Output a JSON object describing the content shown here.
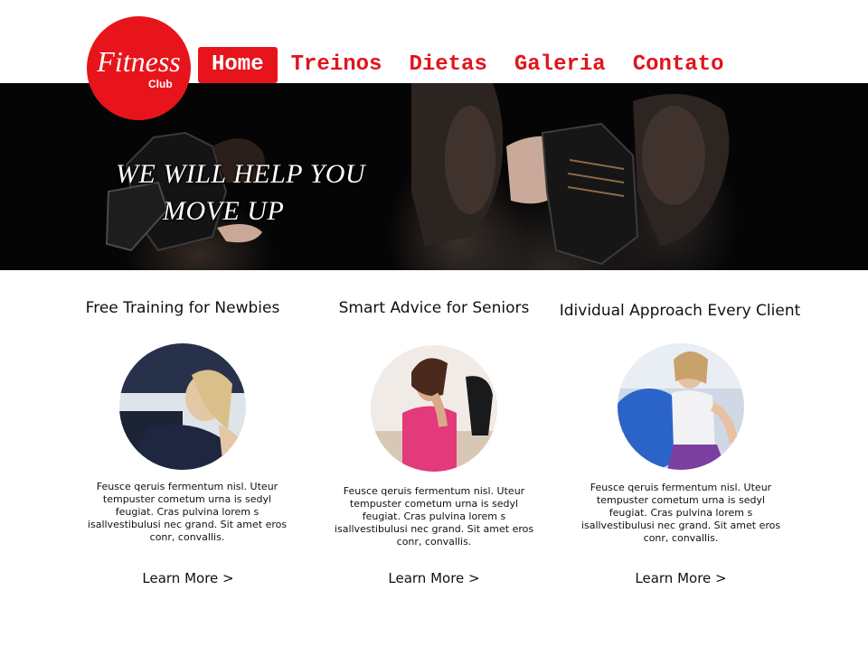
{
  "logo": {
    "title": "Fitness",
    "subtitle": "Club"
  },
  "nav": {
    "items": [
      {
        "label": "Home"
      },
      {
        "label": "Treinos"
      },
      {
        "label": "Dietas"
      },
      {
        "label": "Galeria"
      },
      {
        "label": "Contato"
      }
    ]
  },
  "hero": {
    "line1": "WE WILL HELP YOU",
    "line2": "MOVE UP"
  },
  "features": [
    {
      "title": "Free Training for Newbies",
      "text": "Feusce qeruis fermentum nisl.  Uteur tempuster cometum urna is sedyl feugiat.  Cras  pulvina lorem s isallvestibulusi nec grand. Sit amet eros conr, convallis.",
      "link": "Learn More >"
    },
    {
      "title": "Smart Advice for Seniors",
      "text": "Feusce qeruis fermentum nisl.  Uteur tempuster cometum urna is sedyl feugiat.  Cras  pulvina lorem s isallvestibulusi nec grand. Sit amet eros conr, convallis.",
      "link": "Learn More >"
    },
    {
      "title": "Idividual Approach Every Client",
      "text": "Feusce qeruis fermentum nisl.  Uteur tempuster cometum urna is sedyl feugiat.  Cras  pulvina lorem s isallvestibulusi nec grand. Sit amet eros conr, convallis.",
      "link": "Learn More >"
    }
  ],
  "colors": {
    "accent": "#e8141b",
    "text": "#111111",
    "hero_bg": "#050505"
  }
}
